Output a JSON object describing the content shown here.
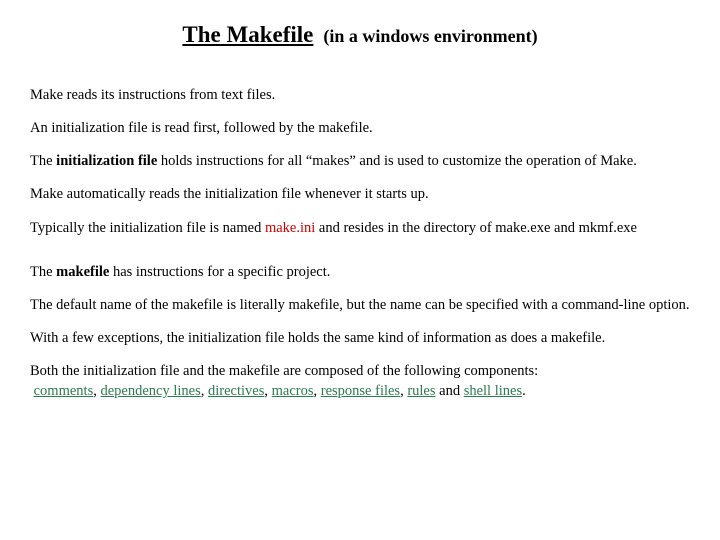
{
  "title": {
    "main": "The Makefile",
    "sub": "(in a windows environment)"
  },
  "p1": "Make reads its instructions from text files.",
  "p2": "An initialization file is read first, followed by the makefile.",
  "p3a": "The ",
  "p3b": "initialization file",
  "p3c": " holds instructions for all “makes” and is used to customize the operation of Make.",
  "p4": "Make automatically reads the initialization file whenever it starts up.",
  "p5a": "Typically the initialization file is named ",
  "p5b": "make.ini",
  "p5c": " and resides in the directory of make.exe and mkmf.exe",
  "p6a": "The ",
  "p6b": "makefile",
  "p6c": " has instructions for a specific project.",
  "p7": "The default name of the makefile is literally makefile, but the name can be specified with a command-line option.",
  "p8": "With a few exceptions, the initialization file holds the same kind of information as does a makefile.",
  "p9": "Both the initialization file and the makefile are composed of the following components:",
  "links": {
    "comments": "comments",
    "dependency": "dependency lines",
    "directives": "directives",
    "macros": "macros",
    "response": "response files",
    "rules": "rules",
    "shell": "shell lines"
  },
  "sep_comma": ", ",
  "sep_and": " and ",
  "sep_period": "."
}
